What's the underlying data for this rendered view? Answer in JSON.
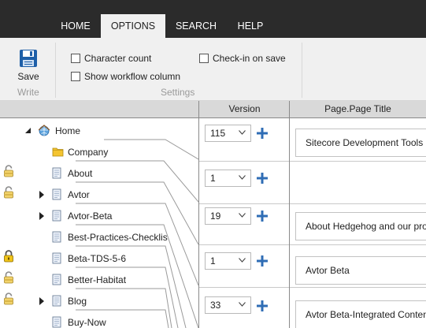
{
  "tabs": [
    {
      "label": "HOME",
      "active": false
    },
    {
      "label": "OPTIONS",
      "active": true
    },
    {
      "label": "SEARCH",
      "active": false
    },
    {
      "label": "HELP",
      "active": false
    }
  ],
  "ribbon": {
    "save_label": "Save",
    "write_group": "Write",
    "settings_group": "Settings",
    "checkboxes": [
      {
        "label": "Character count",
        "checked": false
      },
      {
        "label": "Show workflow column",
        "checked": false
      },
      {
        "label": "Check-in on save",
        "checked": false
      }
    ]
  },
  "grid": {
    "col_version": "Version",
    "col_title": "Page.Page Title",
    "tree": [
      {
        "label": "Home",
        "icon": "home-globe-icon",
        "expander": "expanded",
        "lock": "none"
      },
      {
        "label": "Company",
        "icon": "folder-icon",
        "expander": "none",
        "lock": "none"
      },
      {
        "label": "About",
        "icon": "page-icon",
        "expander": "none",
        "lock": "unlocked"
      },
      {
        "label": "Avtor",
        "icon": "page-icon",
        "expander": "collapsed",
        "lock": "unlocked"
      },
      {
        "label": "Avtor-Beta",
        "icon": "page-icon",
        "expander": "collapsed",
        "lock": "none"
      },
      {
        "label": "Best-Practices-Checklis",
        "icon": "page-icon",
        "expander": "none",
        "lock": "none"
      },
      {
        "label": "Beta-TDS-5-6",
        "icon": "page-icon",
        "expander": "none",
        "lock": "locked"
      },
      {
        "label": "Better-Habitat",
        "icon": "page-icon",
        "expander": "none",
        "lock": "unlocked"
      },
      {
        "label": "Blog",
        "icon": "page-icon",
        "expander": "collapsed",
        "lock": "unlocked"
      },
      {
        "label": "Buy-Now",
        "icon": "page-icon",
        "expander": "none",
        "lock": "none"
      }
    ],
    "records": [
      {
        "version": "115",
        "title": "Sitecore Development Tools"
      },
      {
        "version": "1",
        "title": ""
      },
      {
        "version": "19",
        "title": "About Hedgehog and our pro"
      },
      {
        "version": "1",
        "title": "Avtor Beta"
      },
      {
        "version": "33",
        "title": "Avtor Beta-Integrated Conten"
      }
    ]
  },
  "colors": {
    "topbar": "#2b2b2b",
    "ribbon": "#f0f0f0",
    "header": "#d9d9d9",
    "plus": "#2f6db5",
    "save_icon": "#1e5fa8"
  }
}
